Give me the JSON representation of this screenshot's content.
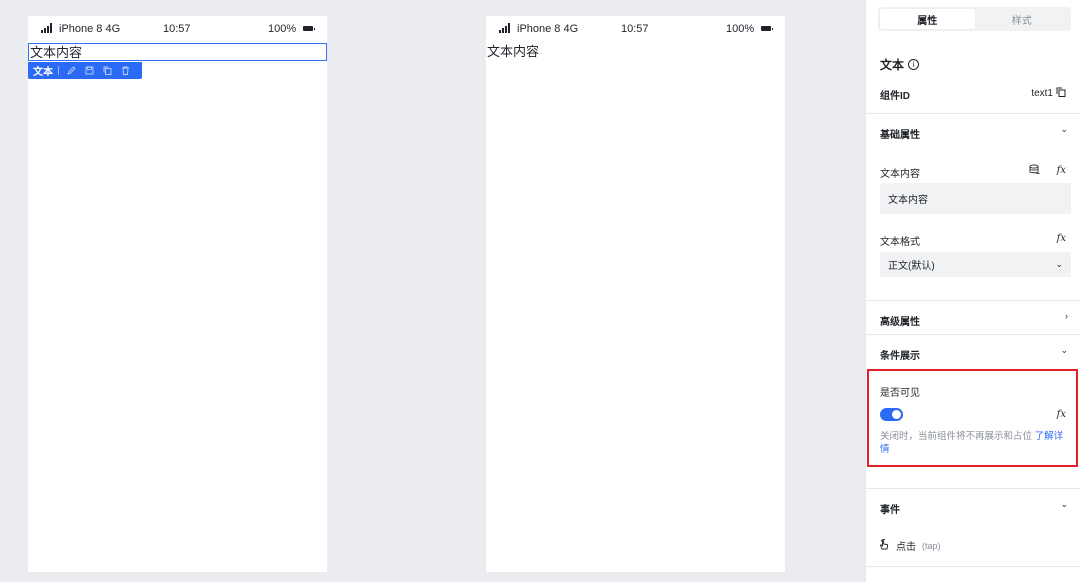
{
  "phones": [
    {
      "statusbar": {
        "carrier": "iPhone 8  4G",
        "time": "10:57",
        "battery": "100%"
      },
      "text_content": "文本内容",
      "selected": true
    },
    {
      "statusbar": {
        "carrier": "iPhone 8  4G",
        "time": "10:57",
        "battery": "100%"
      },
      "text_content": "文本内容",
      "selected": false
    }
  ],
  "toolbar": {
    "label": "文本",
    "icons": [
      "edit-icon",
      "save-icon",
      "copy-icon",
      "delete-icon"
    ]
  },
  "panel": {
    "tabs": [
      {
        "label": "属性",
        "active": true
      },
      {
        "label": "样式",
        "active": false
      }
    ],
    "component_title": "文本",
    "info_glyph": "i",
    "component_id_label": "组件ID",
    "component_id_value": "text1",
    "basic_section": "基础属性",
    "text_content_label": "文本内容",
    "text_content_value": "文本内容",
    "text_format_label": "文本格式",
    "text_format_value": "正文(默认)",
    "advanced_section": "高级属性",
    "conditional_section": "条件展示",
    "visible_label": "是否可见",
    "visible_toggle": true,
    "hint_text": "关闭时，当前组件将不再展示和占位 ",
    "hint_link": "了解详情",
    "events_section": "事件",
    "event_tap_label": "点击",
    "event_tap_sub": "(tap)",
    "fx_label": "fx"
  },
  "colors": {
    "accent": "#2b6af5",
    "highlight_border": "#e0202a",
    "background": "#ebecf0"
  }
}
